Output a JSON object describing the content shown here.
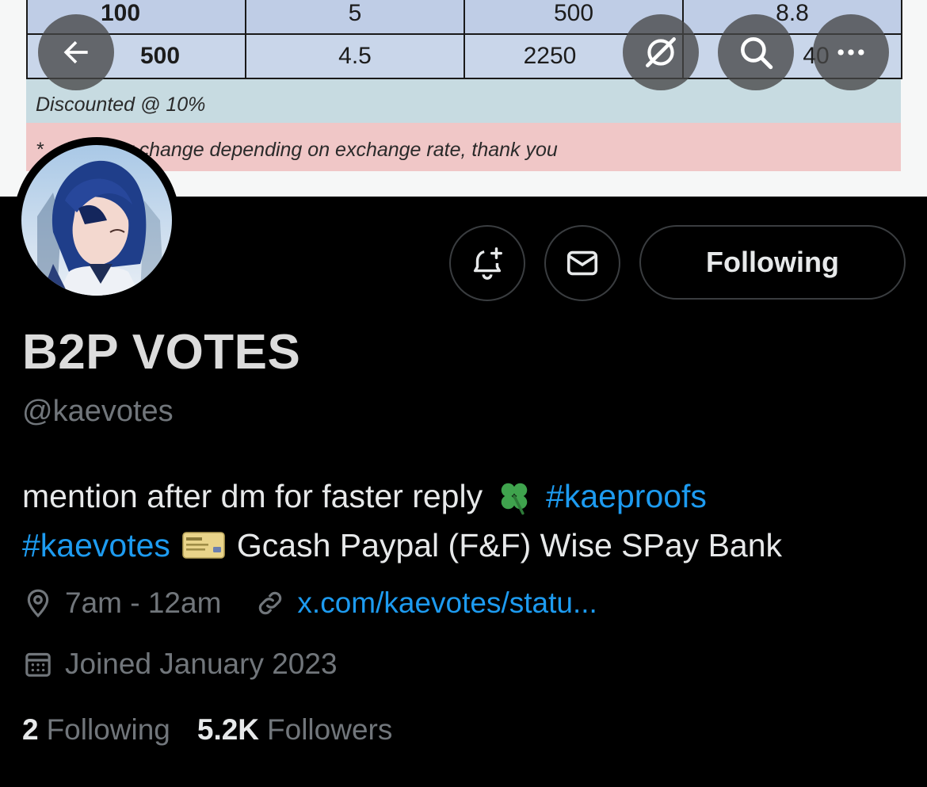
{
  "banner": {
    "table_rows": [
      [
        "100",
        "5",
        "500",
        "8.8"
      ],
      [
        "500",
        "4.5",
        "2250",
        "40"
      ]
    ],
    "discount_text": "Discounted @ 10%",
    "note_text": "* ...ice may change depending on exchange rate, thank you"
  },
  "nav": {
    "back_icon": "arrow-left-icon",
    "grok_icon": "grok-icon",
    "search_icon": "search-icon",
    "more_icon": "more-horizontal-icon"
  },
  "profile": {
    "display_name": "B2P VOTES",
    "handle": "@kaevotes",
    "bio_line1_text": "mention after dm for faster reply",
    "bio_line1_emoji": "🍀",
    "bio_hashtag1": "#kaeproofs",
    "bio_hashtag2": "#kaevotes",
    "bio_line2_emoji": "credit-card",
    "bio_line2_text": "Gcash Paypal (F&F) Wise SPay Bank",
    "location": "7am - 12am",
    "website": "x.com/kaevotes/statu...",
    "joined": "Joined January 2023",
    "following_count": "2",
    "following_label": "Following",
    "followers_count": "5.2K",
    "followers_label": "Followers"
  },
  "actions": {
    "notify_icon": "bell-plus-icon",
    "message_icon": "envelope-icon",
    "following_button_label": "Following"
  },
  "colors": {
    "accent": "#1d9bf0",
    "text_primary": "#e7e9ea",
    "text_secondary": "#71767b",
    "background": "#000000",
    "border": "#3a3d40"
  }
}
